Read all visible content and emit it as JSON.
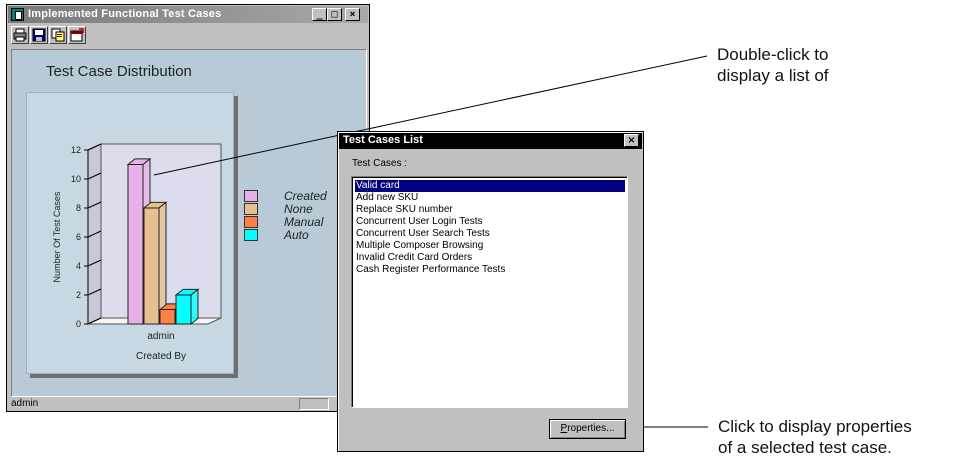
{
  "main_window": {
    "title": "Implemented Functional Test Cases",
    "minimize": "_",
    "maximize": "□",
    "close": "×",
    "toolbar": [
      "print-icon",
      "save-icon",
      "copy-icon",
      "export-icon"
    ],
    "status_text": "admin"
  },
  "chart_data": {
    "type": "bar",
    "title": "Test Case Distribution",
    "xlabel": "Created By",
    "ylabel": "Number Of Test Cases",
    "categories": [
      "admin"
    ],
    "series": [
      {
        "name": "Created",
        "values": [
          11
        ],
        "color": "#e8b0e8"
      },
      {
        "name": "None",
        "values": [
          8
        ],
        "color": "#e8c090"
      },
      {
        "name": "Manual",
        "values": [
          1
        ],
        "color": "#ff8040"
      },
      {
        "name": "Auto",
        "values": [
          2
        ],
        "color": "#00ffff"
      }
    ],
    "ylim": [
      0,
      12
    ],
    "yticks": [
      "0",
      "2",
      "4",
      "6",
      "8",
      "10",
      "12"
    ],
    "legend_position": "right"
  },
  "dialog": {
    "title": "Test Cases List",
    "close": "×",
    "label": "Test Cases :",
    "items": [
      "Valid card",
      "Add new SKU",
      "Replace SKU number",
      "Concurrent User Login Tests",
      "Concurrent User Search Tests",
      "Multiple Composer Browsing",
      "Invalid Credit Card Orders",
      "Cash Register Performance Tests"
    ],
    "selected_index": 0,
    "properties_mnemonic": "P",
    "properties_rest": "roperties..."
  },
  "callouts": {
    "top_line1": "Double-click to",
    "top_line2": "display a list of",
    "bottom_line1": "Click to display properties",
    "bottom_line2": "of a selected test case."
  },
  "colors": {
    "chart_panel": "#b8cad6",
    "selection": "#000080"
  }
}
